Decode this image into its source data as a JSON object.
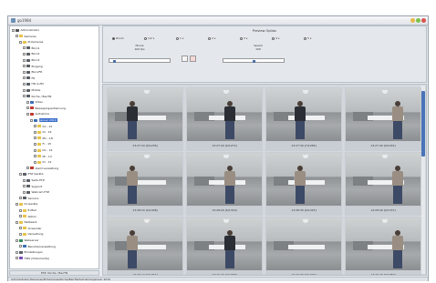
{
  "window": {
    "title": "go1984",
    "buttons": [
      "minimize",
      "maximize",
      "close"
    ],
    "btn_colors": [
      "#e8b84a",
      "#7cc14a",
      "#d9534f"
    ]
  },
  "tree": {
    "items": [
      {
        "label": "Administrator",
        "icon": "user-icon",
        "color": "#555"
      },
      {
        "label": "Kameras",
        "icon": "folder-icon",
        "color": "#e6c34a"
      },
      {
        "label": "IP-Kameras",
        "icon": "folder-icon",
        "color": "#e6c34a"
      },
      {
        "label": "Büro1",
        "icon": "camera-icon",
        "color": "#5a5f66"
      },
      {
        "label": "Büro2",
        "icon": "camera-icon",
        "color": "#5a5f66"
      },
      {
        "label": "Büro3",
        "icon": "camera-icon",
        "color": "#5a5f66"
      },
      {
        "label": "Eingang",
        "icon": "camera-icon",
        "color": "#5a5f66"
      },
      {
        "label": "Büro/FR",
        "icon": "camera-icon",
        "color": "#5a5f66"
      },
      {
        "label": "FR",
        "icon": "camera-icon",
        "color": "#5a5f66"
      },
      {
        "label": "HD-4-2M",
        "icon": "camera-icon",
        "color": "#5a5f66"
      },
      {
        "label": "Mobile",
        "icon": "camera-icon",
        "color": "#5a5f66"
      },
      {
        "label": "Küche / BeoTN",
        "icon": "camera-icon",
        "color": "#5a5f66"
      },
      {
        "label": "Video",
        "icon": "video-icon",
        "color": "#3b6fb6"
      },
      {
        "label": "Bewegungserkennung",
        "icon": "motion-icon",
        "color": "#c0392b"
      },
      {
        "label": "Aufnahme",
        "icon": "record-icon",
        "color": "#c0392b"
      },
      {
        "label": "Januar 2010",
        "icon": "calendar-icon",
        "color": "#3b6fb6",
        "selected": true
      },
      {
        "label": "Do - 21",
        "icon": "day-icon",
        "color": "#e6c34a"
      },
      {
        "label": "Di - 19",
        "icon": "day-icon",
        "color": "#e6c34a"
      },
      {
        "label": "Mo - 18",
        "icon": "day-icon",
        "color": "#e6c34a"
      },
      {
        "label": "Fr - 15",
        "icon": "day-icon",
        "color": "#e6c34a"
      },
      {
        "label": "Do - 14",
        "icon": "day-icon",
        "color": "#e6c34a"
      },
      {
        "label": "Mi - 13",
        "icon": "day-icon",
        "color": "#e6c34a"
      },
      {
        "label": "Di - 12",
        "icon": "day-icon",
        "color": "#e6c34a"
      },
      {
        "label": "Alarmverwaltung",
        "icon": "alarm-icon",
        "color": "#c0392b"
      },
      {
        "label": "PTZ Geräte",
        "icon": "ptz-icon",
        "color": "#5a5f66"
      },
      {
        "label": "Seite PTZ",
        "icon": "ptz-icon",
        "color": "#5a5f66"
      },
      {
        "label": "Support",
        "icon": "support-icon",
        "color": "#5a5f66"
      },
      {
        "label": "Webcam PTZ",
        "icon": "ptz-icon",
        "color": "#5a5f66"
      },
      {
        "label": "Sensors",
        "icon": "sensor-icon",
        "color": "#5a5f66"
      },
      {
        "label": "IO-Geräte",
        "icon": "folder-icon",
        "color": "#e6c34a"
      },
      {
        "label": "E-Mail",
        "icon": "mail-icon",
        "color": "#e6c34a"
      },
      {
        "label": "Aktion",
        "icon": "action-icon",
        "color": "#e6c34a"
      },
      {
        "label": "Netzwerk",
        "icon": "network-icon",
        "color": "#e6c34a"
      },
      {
        "label": "Anwender",
        "icon": "users-icon",
        "color": "#e6c34a"
      },
      {
        "label": "Verwaltung",
        "icon": "admin-icon",
        "color": "#e6c34a"
      },
      {
        "label": "Webserver",
        "icon": "web-icon",
        "color": "#2e8b57"
      },
      {
        "label": "Benutzerverwaltung",
        "icon": "users-icon",
        "color": "#3b6fb6"
      },
      {
        "label": "Einstellungen",
        "icon": "gear-icon",
        "color": "#5a5f66"
      },
      {
        "label": "Hilfe (Dokumente)",
        "icon": "help-icon",
        "color": "#7a4fb5"
      }
    ],
    "footer": "PTZ: Küche / BeoTN"
  },
  "controls": {
    "header": "Preview Option",
    "radios": [
      {
        "label": "Zoom",
        "on": true
      },
      {
        "label": "1/2 s",
        "on": false
      },
      {
        "label": "1 s",
        "on": false
      },
      {
        "label": "2 s",
        "on": false
      },
      {
        "label": "3 s",
        "on": false
      },
      {
        "label": "4 s",
        "on": false
      },
      {
        "label": "5 s",
        "on": false
      }
    ],
    "left_group": {
      "label": "Movie",
      "value": "100 fps"
    },
    "right_group": {
      "label": "Speed",
      "value": "100"
    }
  },
  "thumbnails": [
    {
      "caption": "13:27:10 [0/1236]",
      "person": "dark"
    },
    {
      "caption": "13:27:20 [0/1272]",
      "person": "dark"
    },
    {
      "caption": "13:27:30 [7/1284]",
      "person": "dark"
    },
    {
      "caption": "13:27:40 [0/1291]",
      "person": "light"
    },
    {
      "caption": "13:28:10 [0/1308]",
      "person": "light"
    },
    {
      "caption": "13:28:20 [0/1316]",
      "person": "light"
    },
    {
      "caption": "13:28:30 [0/1325]",
      "person": "light"
    },
    {
      "caption": "13:28:40 [0/1337]",
      "person": "light"
    },
    {
      "caption": "13:29:10 [0/1352]",
      "person": "light"
    },
    {
      "caption": "13:29:20 [0/1368]",
      "person": "dark"
    },
    {
      "caption": "13:29:30 [0/1374]",
      "person": "none"
    },
    {
      "caption": "13:29:40 [0/1389]",
      "person": "light"
    }
  ],
  "status": "Administrator/Kameras/IP-Kameras/Küche/BeoTN/Aufnahme/Januar 2010"
}
